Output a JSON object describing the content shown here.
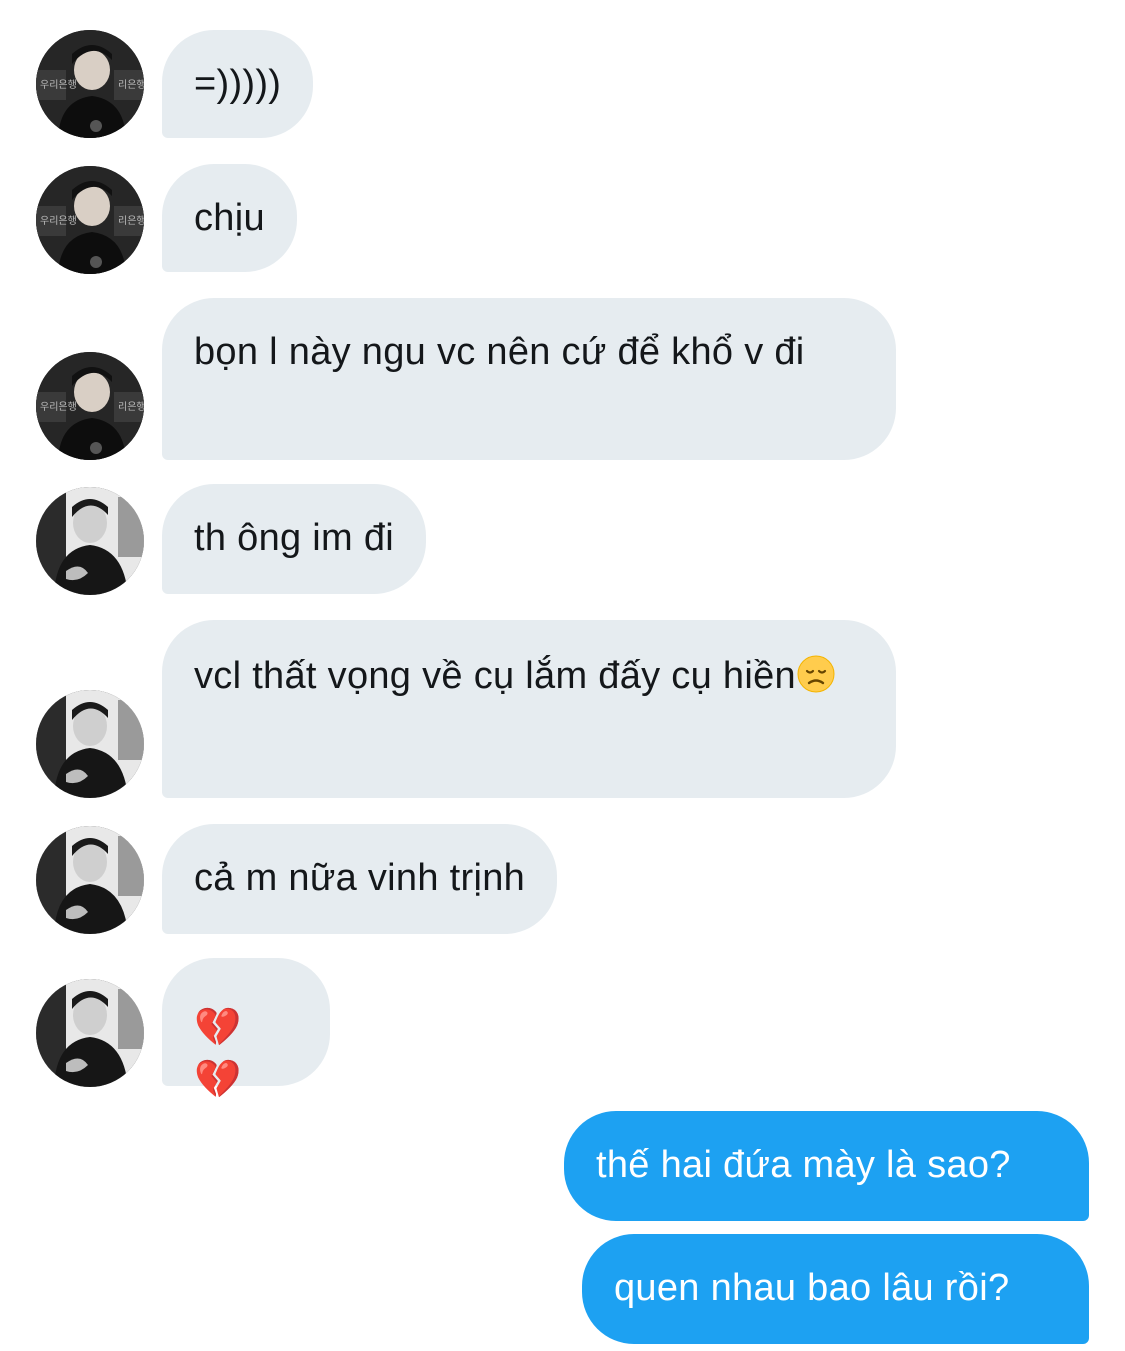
{
  "messages": [
    {
      "text": "=)))))"
    },
    {
      "text": "chịu"
    },
    {
      "text": "bọn l này ngu vc nên cứ để khổ v đi"
    },
    {
      "text": "th ông im đi"
    },
    {
      "text": "vcl thất vọng về cụ lắm đấy cụ hiền",
      "emoji": "disappointed-face"
    },
    {
      "text": "cả m nữa vinh trịnh"
    },
    {
      "text": "💔 💔"
    },
    {
      "text": "thế hai đứa mày là sao?"
    },
    {
      "text": "quen nhau bao lâu rồi?"
    }
  ],
  "colors": {
    "incoming_bubble": "#e6ecf0",
    "outgoing_bubble": "#1da1f2",
    "incoming_text": "#14171a",
    "outgoing_text": "#ffffff"
  }
}
